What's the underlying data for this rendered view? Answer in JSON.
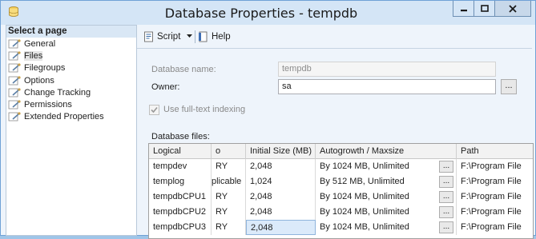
{
  "window": {
    "title": "Database Properties - tempdb"
  },
  "left_pane": {
    "header": "Select a page",
    "pages": [
      {
        "label": "General",
        "selected": false
      },
      {
        "label": "Files",
        "selected": true
      },
      {
        "label": "Filegroups",
        "selected": false
      },
      {
        "label": "Options",
        "selected": false
      },
      {
        "label": "Change Tracking",
        "selected": false
      },
      {
        "label": "Permissions",
        "selected": false
      },
      {
        "label": "Extended Properties",
        "selected": false
      }
    ]
  },
  "toolbar": {
    "script_label": "Script",
    "help_label": "Help"
  },
  "form": {
    "database_name_label": "Database name:",
    "database_name_value": "tempdb",
    "owner_label": "Owner:",
    "owner_value": "sa",
    "owner_browse": "...",
    "fulltext_label": "Use full-text indexing",
    "fulltext_checked": true,
    "database_files_label": "Database files:"
  },
  "files_grid": {
    "columns": [
      "Logical",
      "o",
      "Initial Size (MB)",
      "Autogrowth / Maxsize",
      "",
      "Path"
    ],
    "rows": [
      {
        "logical": "tempdev",
        "type": "RY",
        "size": "2,048",
        "autogrowth": "By 1024 MB, Unlimited",
        "btn": "...",
        "path": "F:\\Program File"
      },
      {
        "logical": "templog",
        "type": "plicable",
        "size": "1,024",
        "autogrowth": "By 512 MB, Unlimited",
        "btn": "...",
        "path": "F:\\Program File"
      },
      {
        "logical": "tempdbCPU1",
        "type": "RY",
        "size": "2,048",
        "autogrowth": "By 1024 MB, Unlimited",
        "btn": "...",
        "path": "F:\\Program File"
      },
      {
        "logical": "tempdbCPU2",
        "type": "RY",
        "size": "2,048",
        "autogrowth": "By 1024 MB, Unlimited",
        "btn": "...",
        "path": "F:\\Program File"
      },
      {
        "logical": "tempdbCPU3",
        "type": "RY",
        "size": "2,048",
        "autogrowth": "By 1024 MB, Unlimited",
        "btn": "...",
        "path": "F:\\Program File"
      }
    ],
    "selected_cell": {
      "row": 4,
      "column": "size"
    }
  },
  "colors": {
    "titlebar": "#d4e5f6",
    "window_bg": "#eef4fb",
    "selected_cell": "#dbeafa"
  }
}
